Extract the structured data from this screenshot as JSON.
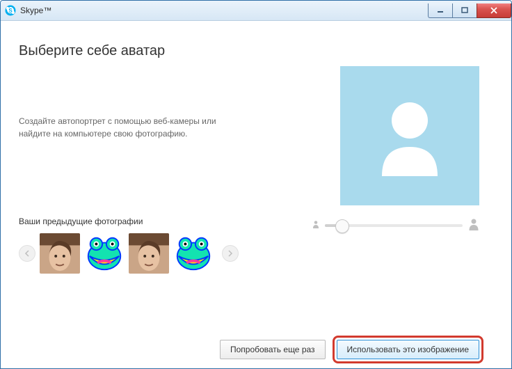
{
  "window": {
    "title": "Skype™"
  },
  "page": {
    "heading": "Выберите себе аватар",
    "instruction": "Создайте автопортрет с помощью веб-камеры или найдите на компьютере свою фотографию.",
    "previous_label": "Ваши предыдущие фотографии"
  },
  "thumbnails": [
    {
      "kind": "photo"
    },
    {
      "kind": "frog"
    },
    {
      "kind": "photo"
    },
    {
      "kind": "frog"
    }
  ],
  "zoom": {
    "value_pct": 12
  },
  "buttons": {
    "retry": "Попробовать еще раз",
    "use_image": "Использовать это изображение"
  },
  "colors": {
    "preview_bg": "#a9daed",
    "highlight_ring": "#d23a2e",
    "primary_border": "#2d8fd6"
  }
}
